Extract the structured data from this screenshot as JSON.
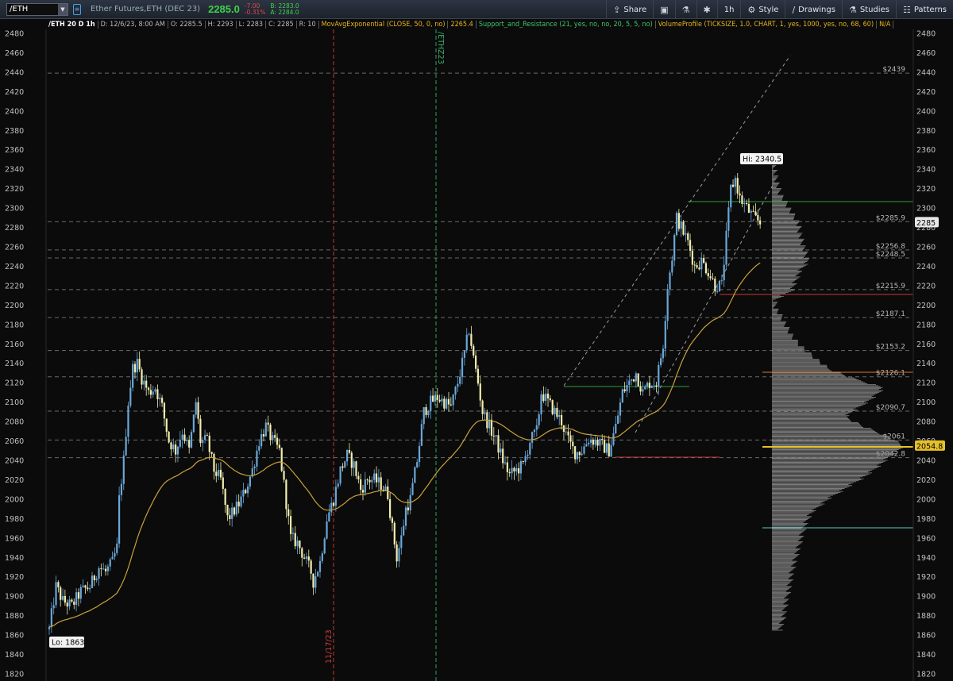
{
  "toolbar": {
    "symbol": "/ETH",
    "instrument": "Ether Futures,ETH (DEC 23)",
    "last": "2285.0",
    "change": "-7.00",
    "change_pct": "-0.31%",
    "bid": "B: 2283.0",
    "ask": "A: 2284.0",
    "buttons": [
      {
        "label": "Share",
        "icon": "share-icon"
      },
      {
        "label": "",
        "icon": "screenshot-icon"
      },
      {
        "label": "",
        "icon": "flask-icon"
      },
      {
        "label": "",
        "icon": "gear-icon"
      },
      {
        "label": "1h",
        "icon": ""
      },
      {
        "label": "Style",
        "icon": "style-icon"
      },
      {
        "label": "Drawings",
        "icon": "pencil-icon"
      },
      {
        "label": "Studies",
        "icon": "flask-icon"
      },
      {
        "label": "Patterns",
        "icon": "patterns-icon"
      }
    ]
  },
  "study_bar": {
    "title": "/ETH 20 D 1h",
    "date": "D: 12/6/23, 8:00 AM",
    "open": "O: 2285.5",
    "high": "H: 2293",
    "low": "L: 2283",
    "close": "C: 2285",
    "range": "R: 10",
    "ema": "MovAvgExponential (CLOSE, 50, 0, no)",
    "ema_val": "2265.4",
    "sr": "Support_and_Resistance (21, yes, no, no, 20, 5, 5, no)",
    "vp": "VolumeProfile (TICKSIZE, 1.0, CHART, 1, yes, 1000, yes, no, 68, 60)",
    "vp_val": "N/A"
  },
  "colors": {
    "background": "#0b0b0b",
    "up": "#6aa7d8",
    "down": "#f2eeb0",
    "ema": "#c9a23a",
    "profile": "#8a8a8a",
    "resistance": "#2e9e3a",
    "support": "#c83a3a",
    "poc": "#e6c029",
    "value_low": "#5ec8c0",
    "value_high": "#d8792c"
  },
  "chart_data": {
    "type": "candlestick",
    "ylim": [
      1815,
      2490
    ],
    "yticks": [
      1820,
      1840,
      1860,
      1880,
      1900,
      1920,
      1940,
      1960,
      1980,
      2000,
      2020,
      2040,
      2060,
      2080,
      2100,
      2120,
      2140,
      2160,
      2180,
      2200,
      2220,
      2240,
      2260,
      2280,
      2300,
      2320,
      2340,
      2360,
      2380,
      2400,
      2420,
      2440,
      2460,
      2480
    ],
    "price_levels": [
      {
        "value": 2439,
        "label": "$2439"
      },
      {
        "value": 2285.9,
        "label": "$2285.9"
      },
      {
        "value": 2256.8,
        "label": "$2256.8"
      },
      {
        "value": 2248.5,
        "label": "$2248.5"
      },
      {
        "value": 2215.9,
        "label": "$2215.9"
      },
      {
        "value": 2187.1,
        "label": "$2187.1"
      },
      {
        "value": 2153.2,
        "label": "$2153.2"
      },
      {
        "value": 2126.1,
        "label": "$2126.1"
      },
      {
        "value": 2090.7,
        "label": "$2090.7"
      },
      {
        "value": 2061,
        "label": "$2061"
      },
      {
        "value": 2042.8,
        "label": "$2042.8"
      }
    ],
    "current_price": {
      "value": 2285,
      "label": "2285"
    },
    "poc": {
      "value": 2054.8,
      "label": "2054.8"
    },
    "high_marker": {
      "value": 2340.5,
      "label": "Hi: 2340.5"
    },
    "low_marker": {
      "value": 1863,
      "label": "Lo: 1863"
    },
    "vertical_markers": [
      {
        "label": "11/17/23",
        "style": "red-dashed"
      },
      {
        "label": "/ETHZ23",
        "style": "green-dashed"
      }
    ],
    "waypoints": [
      [
        0,
        1866
      ],
      [
        3,
        1910
      ],
      [
        6,
        1895
      ],
      [
        10,
        1890
      ],
      [
        14,
        1905
      ],
      [
        18,
        1910
      ],
      [
        22,
        1930
      ],
      [
        25,
        1925
      ],
      [
        28,
        1935
      ],
      [
        30,
        1950
      ],
      [
        31,
        2000
      ],
      [
        33,
        2040
      ],
      [
        35,
        2100
      ],
      [
        37,
        2135
      ],
      [
        39,
        2140
      ],
      [
        41,
        2125
      ],
      [
        44,
        2110
      ],
      [
        47,
        2115
      ],
      [
        50,
        2095
      ],
      [
        53,
        2060
      ],
      [
        56,
        2050
      ],
      [
        59,
        2070
      ],
      [
        62,
        2050
      ],
      [
        65,
        2100
      ],
      [
        67,
        2060
      ],
      [
        70,
        2060
      ],
      [
        73,
        2030
      ],
      [
        76,
        2020
      ],
      [
        79,
        1980
      ],
      [
        81,
        1985
      ],
      [
        84,
        1995
      ],
      [
        87,
        2010
      ],
      [
        90,
        2030
      ],
      [
        93,
        2060
      ],
      [
        96,
        2075
      ],
      [
        99,
        2060
      ],
      [
        102,
        2050
      ],
      [
        104,
        2015
      ],
      [
        107,
        1960
      ],
      [
        110,
        1955
      ],
      [
        113,
        1940
      ],
      [
        116,
        1925
      ],
      [
        117,
        1915
      ],
      [
        120,
        1935
      ],
      [
        123,
        1980
      ],
      [
        126,
        2000
      ],
      [
        129,
        2030
      ],
      [
        132,
        2045
      ],
      [
        135,
        2035
      ],
      [
        138,
        2010
      ],
      [
        141,
        2020
      ],
      [
        144,
        2020
      ],
      [
        147,
        2015
      ],
      [
        150,
        2005
      ],
      [
        152,
        1970
      ],
      [
        154,
        1940
      ],
      [
        156,
        1960
      ],
      [
        158,
        1990
      ],
      [
        160,
        2000
      ],
      [
        163,
        2040
      ],
      [
        166,
        2090
      ],
      [
        169,
        2100
      ],
      [
        172,
        2105
      ],
      [
        175,
        2100
      ],
      [
        178,
        2095
      ],
      [
        181,
        2120
      ],
      [
        184,
        2150
      ],
      [
        186,
        2175
      ],
      [
        188,
        2145
      ],
      [
        190,
        2120
      ],
      [
        192,
        2090
      ],
      [
        195,
        2075
      ],
      [
        198,
        2060
      ],
      [
        201,
        2040
      ],
      [
        204,
        2025
      ],
      [
        207,
        2030
      ],
      [
        210,
        2035
      ],
      [
        213,
        2060
      ],
      [
        216,
        2070
      ],
      [
        218,
        2110
      ],
      [
        221,
        2100
      ],
      [
        224,
        2090
      ],
      [
        227,
        2080
      ],
      [
        230,
        2060
      ],
      [
        233,
        2048
      ],
      [
        236,
        2050
      ],
      [
        239,
        2062
      ],
      [
        242,
        2060
      ],
      [
        245,
        2055
      ],
      [
        248,
        2050
      ],
      [
        251,
        2075
      ],
      [
        254,
        2110
      ],
      [
        257,
        2120
      ],
      [
        260,
        2130
      ],
      [
        263,
        2110
      ],
      [
        266,
        2120
      ],
      [
        269,
        2120
      ],
      [
        272,
        2160
      ],
      [
        274,
        2220
      ],
      [
        276,
        2250
      ],
      [
        278,
        2290
      ],
      [
        280,
        2280
      ],
      [
        283,
        2265
      ],
      [
        286,
        2240
      ],
      [
        289,
        2245
      ],
      [
        292,
        2235
      ],
      [
        295,
        2220
      ],
      [
        298,
        2220
      ],
      [
        300,
        2270
      ],
      [
        302,
        2320
      ],
      [
        304,
        2330
      ],
      [
        306,
        2310
      ],
      [
        309,
        2300
      ],
      [
        312,
        2290
      ],
      [
        315,
        2285
      ]
    ],
    "volume_profile": [
      [
        1865,
        10
      ],
      [
        1880,
        15
      ],
      [
        1895,
        18
      ],
      [
        1910,
        22
      ],
      [
        1925,
        25
      ],
      [
        1940,
        30
      ],
      [
        1955,
        35
      ],
      [
        1970,
        40
      ],
      [
        1985,
        48
      ],
      [
        2000,
        70
      ],
      [
        2015,
        100
      ],
      [
        2025,
        120
      ],
      [
        2035,
        135
      ],
      [
        2045,
        150
      ],
      [
        2055,
        165
      ],
      [
        2065,
        145
      ],
      [
        2075,
        115
      ],
      [
        2085,
        92
      ],
      [
        2095,
        110
      ],
      [
        2105,
        128
      ],
      [
        2115,
        140
      ],
      [
        2125,
        100
      ],
      [
        2135,
        70
      ],
      [
        2145,
        55
      ],
      [
        2155,
        40
      ],
      [
        2165,
        28
      ],
      [
        2175,
        20
      ],
      [
        2185,
        14
      ],
      [
        2195,
        6
      ],
      [
        2205,
        3
      ],
      [
        2215,
        25
      ],
      [
        2225,
        30
      ],
      [
        2235,
        35
      ],
      [
        2245,
        45
      ],
      [
        2255,
        42
      ],
      [
        2265,
        38
      ],
      [
        2275,
        35
      ],
      [
        2285,
        33
      ],
      [
        2295,
        25
      ],
      [
        2305,
        18
      ],
      [
        2315,
        10
      ],
      [
        2325,
        7
      ],
      [
        2335,
        4
      ]
    ]
  }
}
